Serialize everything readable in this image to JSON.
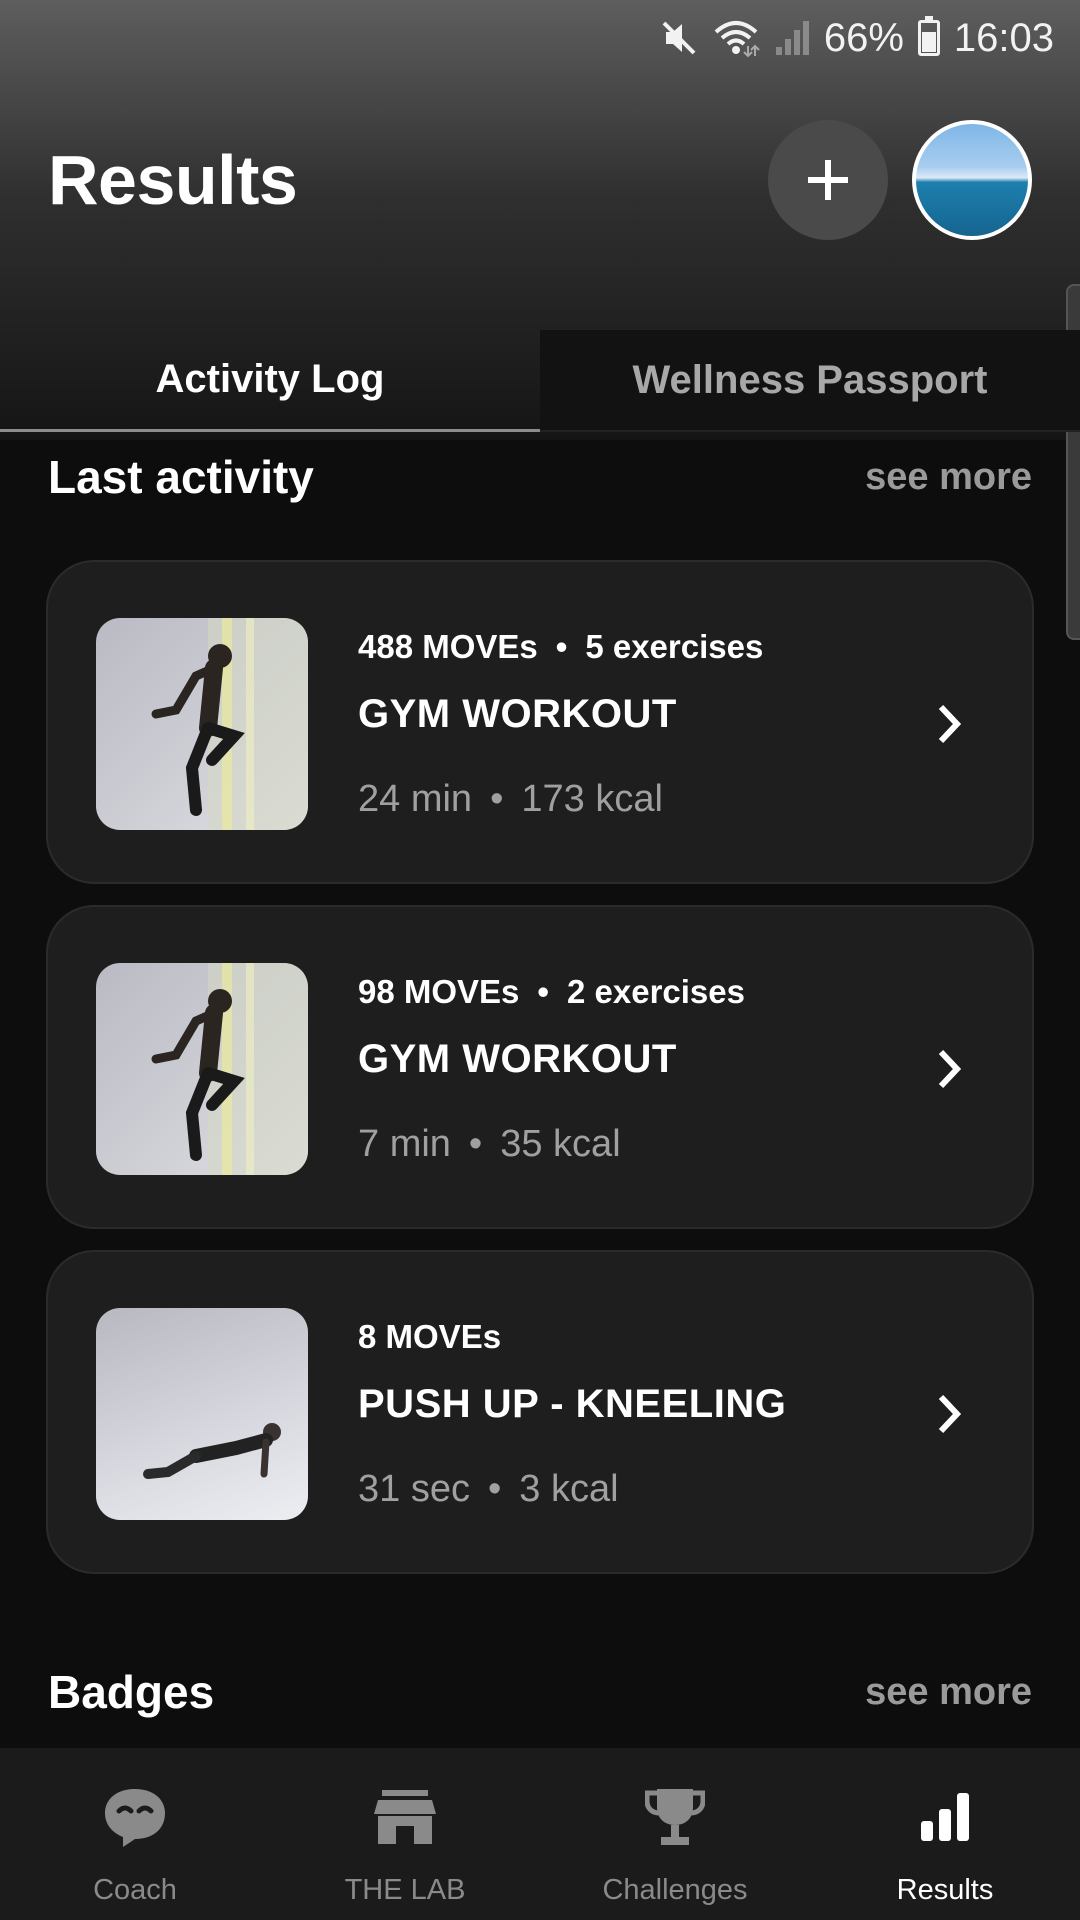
{
  "status_bar": {
    "battery_percent": "66%",
    "time": "16:03",
    "icons": [
      "mute-icon",
      "wifi-icon",
      "signal-icon",
      "battery-icon"
    ]
  },
  "header": {
    "title": "Results",
    "add_icon": "plus-icon"
  },
  "tabs": [
    {
      "label": "Activity Log",
      "active": true
    },
    {
      "label": "Wellness Passport",
      "active": false
    }
  ],
  "last_activity": {
    "title": "Last activity",
    "see_more": "see more",
    "items": [
      {
        "moves": "488 MOVEs",
        "exercises": "5 exercises",
        "title": "GYM WORKOUT",
        "duration": "24 min",
        "kcal": "173 kcal",
        "image": "runner"
      },
      {
        "moves": "98 MOVEs",
        "exercises": "2 exercises",
        "title": "GYM WORKOUT",
        "duration": "7 min",
        "kcal": "35 kcal",
        "image": "runner"
      },
      {
        "moves": "8 MOVEs",
        "exercises": "",
        "title": "PUSH UP - KNEELING",
        "duration": "31 sec",
        "kcal": "3 kcal",
        "image": "pushup"
      }
    ]
  },
  "badges": {
    "title": "Badges",
    "see_more": "see more"
  },
  "bottom_nav": [
    {
      "label": "Coach",
      "icon": "chat-bubble-icon",
      "active": false
    },
    {
      "label": "THE LAB",
      "icon": "store-icon",
      "active": false
    },
    {
      "label": "Challenges",
      "icon": "trophy-icon",
      "active": false
    },
    {
      "label": "Results",
      "icon": "bar-chart-icon",
      "active": true
    }
  ],
  "colors": {
    "background": "#0d0d0d",
    "card": "#1e1e1e",
    "muted_text": "#a0a0a0",
    "nav_background": "#1b1b1b"
  }
}
